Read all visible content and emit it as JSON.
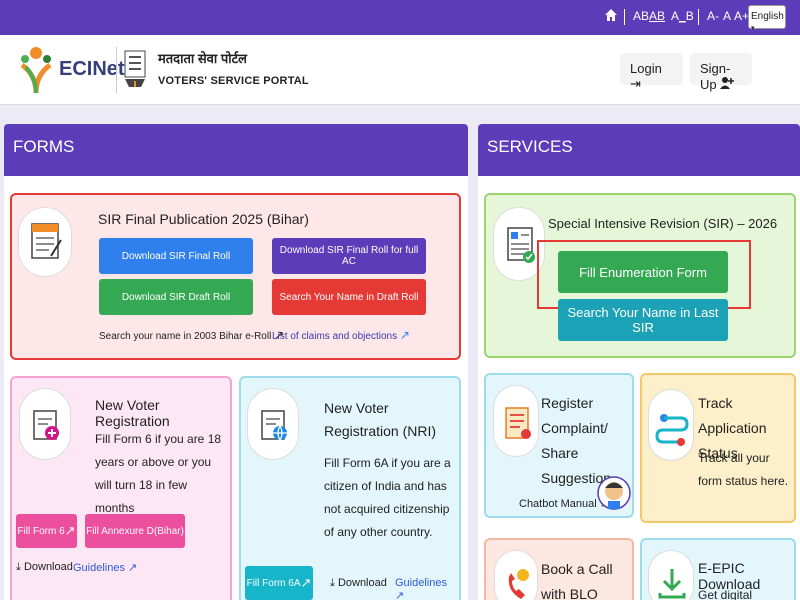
{
  "topbar": {
    "home_icon": "home-icon",
    "font_options": [
      "AB",
      "A̲B",
      "A̲_B"
    ],
    "size_options": [
      "A-",
      "A",
      "A+"
    ],
    "language": "English"
  },
  "header": {
    "logo": "ECINet",
    "hindi_title": "मतदाता सेवा पोर्टल",
    "portal_name": "VOTERS' SERVICE PORTAL",
    "login_label": "Login",
    "signup_label": "Sign-Up"
  },
  "forms": {
    "title": "FORMS",
    "sir_card": {
      "title": "SIR Final Publication 2025 (Bihar)",
      "icon_label": "EF Form",
      "buttons": [
        "Download SIR Final Roll",
        "Download SIR Final Roll for full AC",
        "Download SIR Draft Roll",
        "Search Your Name in Draft Roll"
      ],
      "link1": "Search your name in 2003 Bihar e-Roll",
      "link2": "List of claims and objections"
    },
    "voter_card": {
      "title": "New Voter Registration",
      "desc": "Fill Form 6 if you are 18 years or above or you will turn 18 in few months",
      "btn1": "Fill Form 6",
      "btn2": "Fill Annexure D(Bihar)",
      "download": "Download",
      "guidelines": "Guidelines"
    },
    "nri_card": {
      "title": "New Voter Registration (NRI)",
      "desc": "Fill Form 6A if you are a citizen of India and has not acquired citizenship of any other country.",
      "btn": "Fill Form 6A",
      "download": "Download",
      "guidelines": "Guidelines"
    }
  },
  "services": {
    "title": "SERVICES",
    "sir_card": {
      "title": "Special Intensive Revision (SIR) – 2026",
      "btn1": "Fill Enumeration Form",
      "btn2": "Search Your Name in Last SIR"
    },
    "complaint_card": {
      "title": "Register Complaint/ Share Suggestion",
      "chatbot": "Chatbot Manual"
    },
    "track_card": {
      "title": "Track Application Status",
      "desc": "Track all your form status here."
    },
    "blo_card": {
      "title": "Book a Call with BLO"
    },
    "epic_card": {
      "title": "E-EPIC Download",
      "desc": "Get digital version"
    }
  },
  "colors": {
    "primary": "#5c3cb8",
    "blue_btn": "#2f80ed",
    "purple_btn": "#5c3cb8",
    "green_btn": "#34a853",
    "red_btn": "#e53935",
    "pink_btn": "#ec4f9e",
    "cyan_btn": "#16b5c9",
    "highlight": "#e53935"
  }
}
